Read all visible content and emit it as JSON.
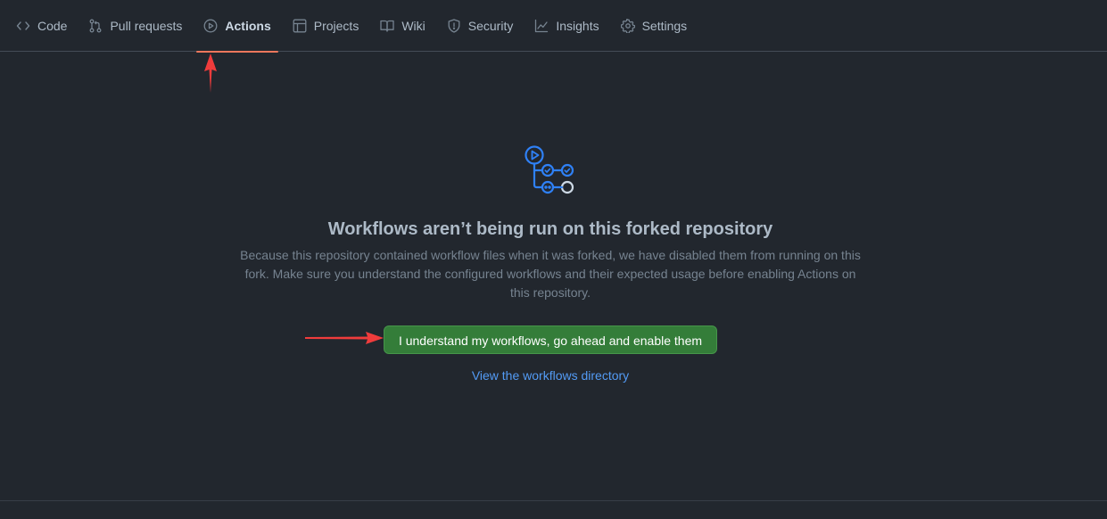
{
  "nav": {
    "tabs": [
      {
        "label": "Code",
        "icon": "code-icon"
      },
      {
        "label": "Pull requests",
        "icon": "git-pull-request-icon"
      },
      {
        "label": "Actions",
        "icon": "play-circle-icon",
        "active": true
      },
      {
        "label": "Projects",
        "icon": "table-icon"
      },
      {
        "label": "Wiki",
        "icon": "book-icon"
      },
      {
        "label": "Security",
        "icon": "shield-icon"
      },
      {
        "label": "Insights",
        "icon": "graph-icon"
      },
      {
        "label": "Settings",
        "icon": "gear-icon"
      }
    ],
    "active_underline_color": "#ec775c"
  },
  "blankslate": {
    "icon": "workflow-icon",
    "title": "Workflows aren’t being run on this forked repository",
    "description": "Because this repository contained workflow files when it was forked, we have disabled them from running on this fork. Make sure you understand the configured workflows and their expected usage before enabling Actions on this repository.",
    "enable_button_label": "I understand my workflows, go ahead and enable them",
    "view_link_label": "View the workflows directory"
  },
  "annotations": {
    "arrow_color": "#f03c3c"
  },
  "colors": {
    "background": "#22272e",
    "button_green": "#347d39",
    "link_blue": "#539bf5",
    "icon_blue": "#2f81f7"
  }
}
